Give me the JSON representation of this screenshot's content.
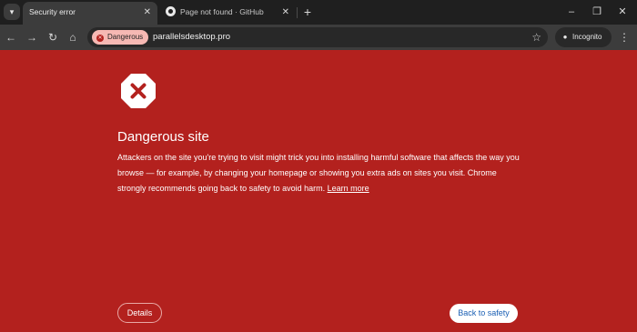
{
  "tabs": [
    {
      "title": "Security error",
      "close": "✕"
    },
    {
      "title": "Page not found · GitHub",
      "close": "✕"
    }
  ],
  "tabstrip": {
    "menu_icon": "chevron-down-icon",
    "newtab_label": "+"
  },
  "window_controls": {
    "minimize": "–",
    "maximize": "❐",
    "close": "✕"
  },
  "toolbar": {
    "back": "←",
    "forward": "→",
    "reload": "↻",
    "home": "⌂",
    "security_chip": "Dangerous",
    "url": "parallelsdesktop.pro",
    "star": "☆",
    "incognito_label": "Incognito",
    "menu": "⋮"
  },
  "interstitial": {
    "heading": "Dangerous site",
    "body": "Attackers on the site you're trying to visit might trick you into installing harmful software that affects the way you browse — for example, by changing your homepage or showing you extra ads on sites you visit. Chrome strongly recommends going back to safety to avoid harm. ",
    "learn_more": "Learn more",
    "details_label": "Details",
    "back_to_safety_label": "Back to safety"
  },
  "colors": {
    "page_background": "#b3211e",
    "tabstrip": "#1f1f1f",
    "toolbar": "#3c3c3c",
    "danger_chip": "#f6b8b3",
    "primary_button_text": "#1a5fb4"
  }
}
